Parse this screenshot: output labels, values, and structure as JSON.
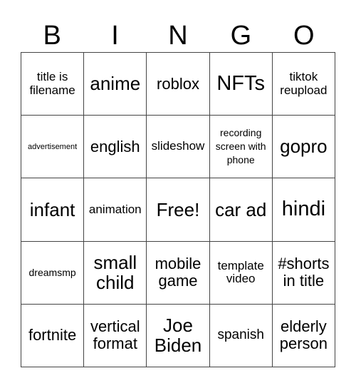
{
  "header": [
    "B",
    "I",
    "N",
    "G",
    "O"
  ],
  "cells": [
    {
      "text": "title is filename",
      "size": "s-m"
    },
    {
      "text": "anime",
      "size": "s-xl"
    },
    {
      "text": "roblox",
      "size": "s-l"
    },
    {
      "text": "NFTs",
      "size": "s-xxl"
    },
    {
      "text": "tiktok reupload",
      "size": "s-m"
    },
    {
      "text": "advertisement",
      "size": "s-xs"
    },
    {
      "text": "english",
      "size": "s-l"
    },
    {
      "text": "slideshow",
      "size": "s-m"
    },
    {
      "text": "recording screen with phone",
      "size": "s-s"
    },
    {
      "text": "gopro",
      "size": "s-xl"
    },
    {
      "text": "infant",
      "size": "s-xl"
    },
    {
      "text": "animation",
      "size": "s-m"
    },
    {
      "text": "Free!",
      "size": "s-xl"
    },
    {
      "text": "car ad",
      "size": "s-xl"
    },
    {
      "text": "hindi",
      "size": "s-xxl"
    },
    {
      "text": "dreamsmp",
      "size": "s-s"
    },
    {
      "text": "small child",
      "size": "s-xl"
    },
    {
      "text": "mobile game",
      "size": "s-l"
    },
    {
      "text": "template video",
      "size": "s-m"
    },
    {
      "text": "#shorts in title",
      "size": "s-l"
    },
    {
      "text": "fortnite",
      "size": "s-l"
    },
    {
      "text": "vertical format",
      "size": "s-l"
    },
    {
      "text": "Joe Biden",
      "size": "s-xl"
    },
    {
      "text": "spanish",
      "size": "s-ml"
    },
    {
      "text": "elderly person",
      "size": "s-l"
    }
  ]
}
